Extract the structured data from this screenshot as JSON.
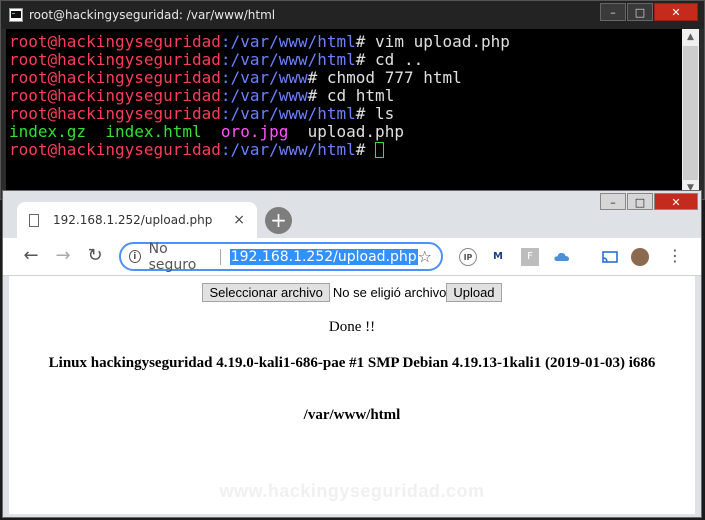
{
  "terminal": {
    "title": "root@hackingyseguridad: /var/www/html",
    "lines": [
      {
        "user": "root@hackingyseguridad",
        "path": ":/var/www/html",
        "sym": "# ",
        "cmd": "vim upload.php"
      },
      {
        "user": "root@hackingyseguridad",
        "path": ":/var/www/html",
        "sym": "# ",
        "cmd": "cd .."
      },
      {
        "user": "root@hackingyseguridad",
        "path": ":/var/www",
        "sym": "# ",
        "cmd": "chmod 777 html"
      },
      {
        "user": "root@hackingyseguridad",
        "path": ":/var/www",
        "sym": "# ",
        "cmd": "cd html"
      },
      {
        "user": "root@hackingyseguridad",
        "path": ":/var/www/html",
        "sym": "# ",
        "cmd": "ls"
      }
    ],
    "ls_output": {
      "file1": "index.gz",
      "file2": "index.html",
      "file3": "oro.jpg",
      "file4": "upload.php"
    },
    "prompt": {
      "user": "root@hackingyseguridad",
      "path": ":/var/www/html",
      "sym": "# "
    }
  },
  "browser": {
    "tab_title": "192.168.1.252/upload.php",
    "tab_close": "×",
    "new_tab": "+",
    "omnibox": {
      "security": "No seguro",
      "url": "192.168.1.252/upload.php"
    },
    "page": {
      "choose_button": "Seleccionar archivo",
      "no_file": "No se eligió archivo",
      "upload_button": "Upload",
      "done": "Done !!",
      "uname": "Linux hackingyseguridad 4.19.0-kali1-686-pae #1 SMP Debian 4.19.13-1kali1 (2019-01-03) i686",
      "cwd": "/var/www/html",
      "watermark": "www.hackingyseguridad.com"
    }
  },
  "colors": {
    "user": "#ff3c5a",
    "path": "#6a80ff",
    "dir": "#6a80ff",
    "file": "#33e033",
    "image": "#ff55ff",
    "url_highlight": "#3390ff"
  }
}
